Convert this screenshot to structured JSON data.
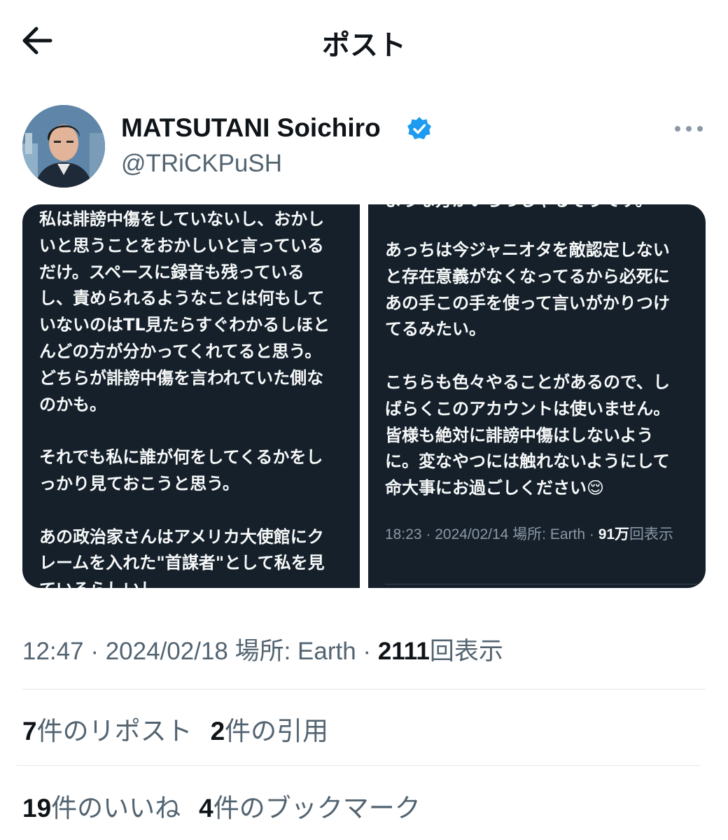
{
  "header": {
    "title": "ポスト",
    "back_icon": "arrow-left-icon"
  },
  "author": {
    "display_name": "MATSUTANI Soichiro",
    "handle": "@TRiCKPuSH",
    "verified_icon": "verified-badge-icon",
    "more_icon": "more-horizontal-icon",
    "avatar_icon": "avatar-photo"
  },
  "media": {
    "left_text": "私は誹謗中傷をしていないし、おかし\nいと思うことをおかしいと言っている\nだけ。スペースに録音も残っている\nし、責められるようなことは何もして\nいないのはTL見たらすぐわかるしほと\nんどの方が分かってくれてると思う。\nどちらが誹謗中傷を言われていた側な\nのかも。\n\nそれでも私に誰が何をしてくるかをし\nっかり見ておこうと思う。\n\nあの政治家さんはアメリカ大使館にク\nレームを入れた\"首謀者\"として私を見\nているらしいし",
    "right_cutoff": "ような方がいらっしゃるそうです。",
    "right_text": "あっちは今ジャニオタを敵認定しない\nと存在意義がなくなってるから必死に\nあの手この手を使って言いがかりつけ\nてるみたい。\n\nこちらも色々やることがあるので、し\nばらくこのアカウントは使いません。\n皆様も絶対に誹謗中傷はしないよう\nに。変なやつには触れないようにして\n命大事にお過ごしください😌",
    "right_meta_prefix": "18:23 · 2024/02/14 場所: Earth · ",
    "right_meta_views": "91万",
    "right_meta_suffix": "回表示"
  },
  "meta": {
    "time": "12:47",
    "sep1": " · ",
    "date": "2024/02/18",
    "location": " 場所: Earth · ",
    "views_count": "2111",
    "views_label": "回表示"
  },
  "stats": {
    "reposts_count": "7",
    "reposts_label": "件のリポスト",
    "quotes_count": "2",
    "quotes_label": "件の引用",
    "likes_count": "19",
    "likes_label": "件のいいね",
    "bookmarks_count": "4",
    "bookmarks_label": "件のブックマーク"
  },
  "colors": {
    "verified": "#1d9bf0",
    "card_bg": "#15202b",
    "text_primary": "#0f1419",
    "text_secondary": "#536471"
  }
}
